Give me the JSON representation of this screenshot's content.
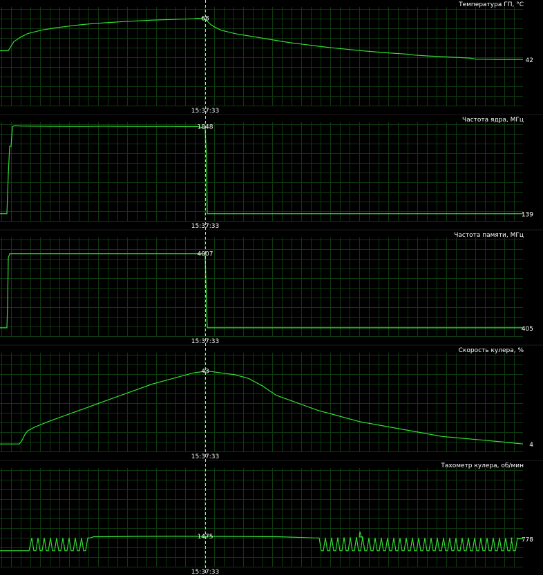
{
  "window": {
    "background": "#000000",
    "grid_color": "#0f3a0f",
    "line_color": "#33dd33",
    "marker_color": "#e8d84a",
    "text_color": "#ffffff"
  },
  "marker_time": "15:37:33",
  "chart_data": [
    {
      "type": "line",
      "title": "Температура ГП, °C",
      "ylim": [
        30,
        75
      ],
      "current_label": "42",
      "marker_label": "68",
      "grid": true,
      "x": [
        0,
        12,
        16,
        20,
        25,
        30,
        40,
        60,
        80,
        100,
        120,
        140,
        160,
        180,
        200,
        220,
        240,
        260,
        280,
        286,
        295,
        300,
        305,
        310,
        320,
        340,
        360,
        380,
        400,
        420,
        440,
        460,
        480,
        500,
        520,
        540,
        560,
        580,
        590,
        600,
        620,
        640,
        660,
        680,
        690,
        700,
        720,
        740,
        757
      ],
      "values": [
        54.0,
        54.0,
        56.0,
        58.0,
        59.0,
        60.0,
        61.5,
        63.0,
        64.0,
        64.8,
        65.5,
        66.0,
        66.4,
        66.8,
        67.1,
        67.4,
        67.6,
        67.8,
        68.0,
        68.2,
        68.0,
        67.0,
        65.5,
        64.5,
        63.0,
        61.5,
        60.5,
        59.5,
        58.5,
        57.5,
        56.8,
        56.0,
        55.3,
        54.7,
        54.1,
        53.6,
        53.1,
        52.7,
        52.5,
        52.1,
        51.7,
        51.4,
        51.1,
        50.8,
        50.3,
        50.3,
        50.2,
        50.2,
        50.2
      ]
    },
    {
      "type": "line",
      "title": "Частота ядра, МГц",
      "ylim": [
        0,
        2000
      ],
      "current_label": "139",
      "marker_label": "1848",
      "grid": true,
      "x": [
        0,
        10,
        12,
        14,
        16,
        18,
        20,
        22,
        30,
        60,
        90,
        120,
        150,
        180,
        210,
        240,
        270,
        286,
        297,
        299,
        300,
        302,
        757
      ],
      "values": [
        139,
        139,
        900,
        1450,
        1450,
        1830,
        1848,
        1850,
        1845,
        1840,
        1838,
        1835,
        1840,
        1838,
        1835,
        1837,
        1832,
        1835,
        1800,
        1200,
        139,
        139,
        139
      ]
    },
    {
      "type": "line",
      "title": "Частота памяти, МГц",
      "ylim": [
        0,
        5000
      ],
      "current_label": "405",
      "marker_label": "4007",
      "grid": true,
      "x": [
        0,
        10,
        11,
        12,
        14,
        286,
        297,
        299,
        300,
        757
      ],
      "values": [
        405,
        405,
        1500,
        3800,
        4007,
        4007,
        4007,
        1500,
        405,
        405
      ]
    },
    {
      "type": "line",
      "title": "Скорость кулера, %",
      "ylim": [
        0,
        55
      ],
      "current_label": "4",
      "marker_label": "43",
      "grid": true,
      "x": [
        0,
        28,
        32,
        36,
        40,
        50,
        70,
        100,
        130,
        160,
        190,
        220,
        250,
        280,
        300,
        320,
        340,
        360,
        380,
        400,
        430,
        460,
        490,
        520,
        550,
        580,
        610,
        640,
        670,
        700,
        730,
        757
      ],
      "values": [
        4,
        4,
        6,
        9,
        11,
        13,
        16,
        20,
        24,
        28,
        32,
        36,
        39,
        42,
        43,
        42,
        41,
        39,
        35,
        30,
        26,
        22,
        19,
        16,
        14,
        12,
        10,
        8,
        7,
        6,
        5,
        4
      ]
    },
    {
      "type": "line",
      "title": "Тахометр кулера, об/мин",
      "ylim": [
        0,
        5000
      ],
      "current_label": "778",
      "marker_label": "1475",
      "grid": true,
      "x": [
        0,
        42,
        46,
        130,
        136,
        150,
        200,
        250,
        300,
        350,
        400,
        440,
        455,
        462,
        520,
        521,
        523,
        525,
        740,
        750,
        757
      ],
      "values": [
        778,
        778,
        1400,
        1400,
        1460,
        1460,
        1475,
        1480,
        1475,
        1470,
        1460,
        1420,
        1400,
        1400,
        1450,
        1700,
        1450,
        1400,
        1400,
        1360,
        1360
      ],
      "oscillation_bands": [
        [
          46,
          130
        ],
        [
          462,
          750
        ]
      ]
    }
  ]
}
